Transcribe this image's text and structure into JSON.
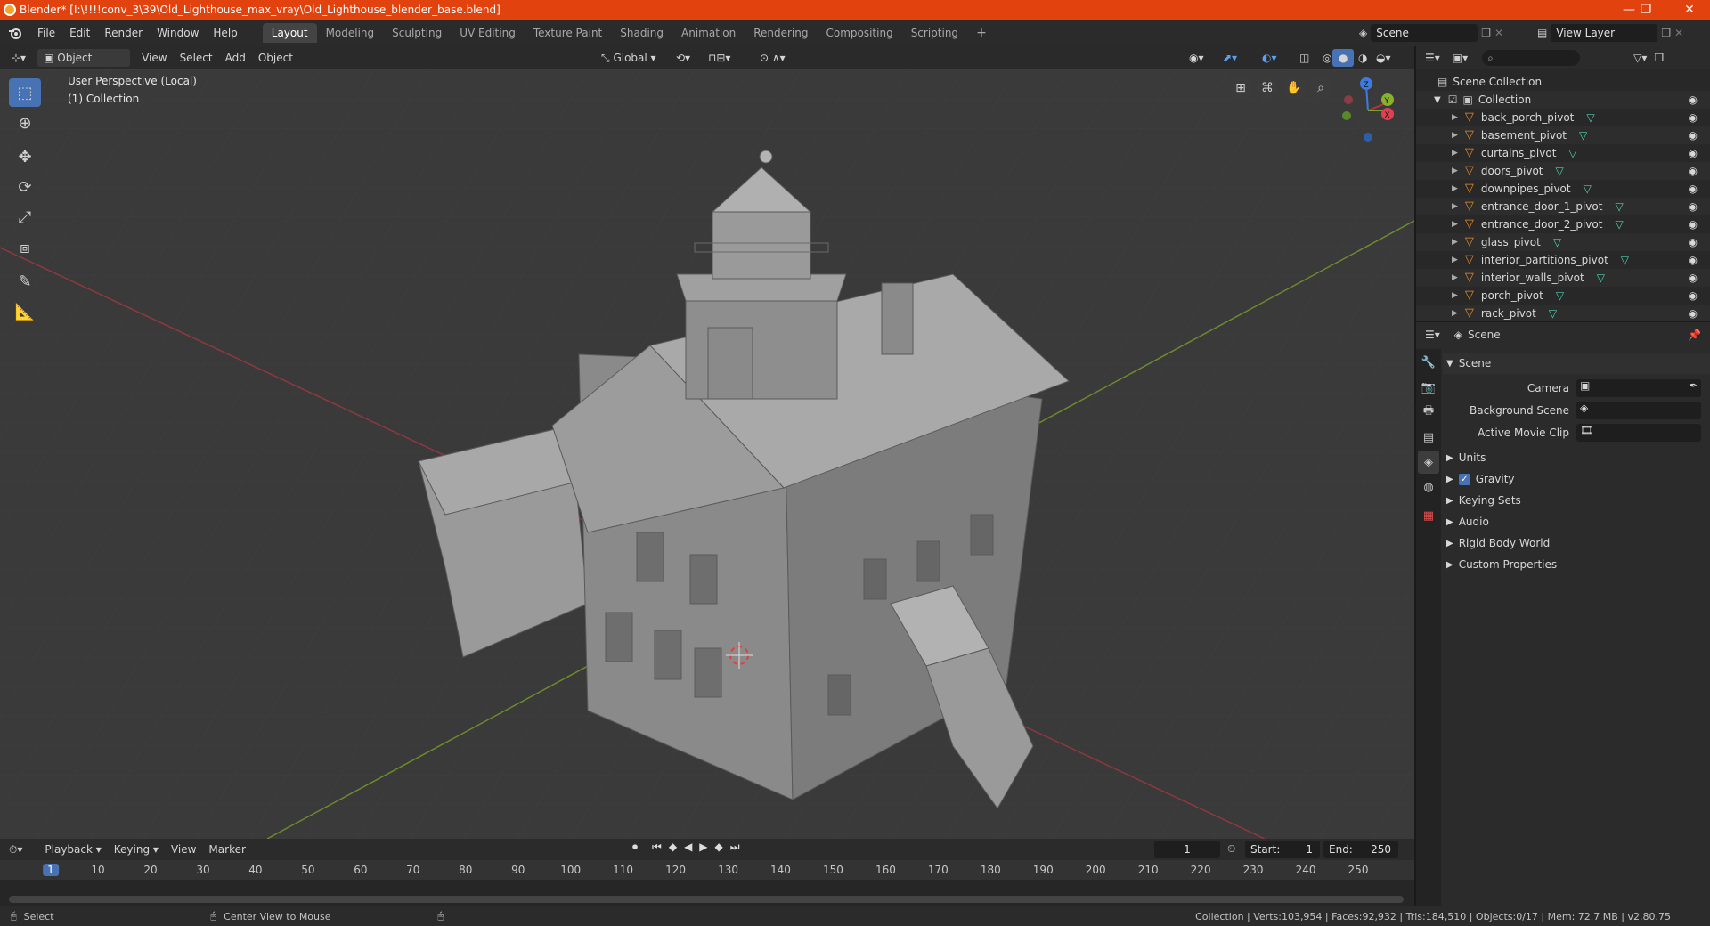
{
  "window": {
    "title": "Blender* [I:\\!!!!conv_3\\39\\Old_Lighthouse_max_vray\\Old_Lighthouse_blender_base.blend]",
    "minimize": "—",
    "maximize": "❐",
    "close": "✕"
  },
  "menu": [
    "File",
    "Edit",
    "Render",
    "Window",
    "Help"
  ],
  "workspaces": [
    "Layout",
    "Modeling",
    "Sculpting",
    "UV Editing",
    "Texture Paint",
    "Shading",
    "Animation",
    "Rendering",
    "Compositing",
    "Scripting"
  ],
  "add_workspace": "+",
  "scene_field": "Scene",
  "view_layer_field": "View Layer",
  "viewport_header": {
    "mode": "Object Mode",
    "menus": [
      "View",
      "Select",
      "Add",
      "Object"
    ],
    "transform_orientation": "Global"
  },
  "viewport": {
    "perspective_label": "User Perspective (Local)",
    "collection_label": "(1) Collection",
    "gizmo_axes": {
      "x": "X",
      "y": "Y",
      "z": "Z"
    }
  },
  "outliner": {
    "root": "Scene Collection",
    "collection": "Collection",
    "items": [
      "back_porch_pivot",
      "basement_pivot",
      "curtains_pivot",
      "doors_pivot",
      "downpipes_pivot",
      "entrance_door_1_pivot",
      "entrance_door_2_pivot",
      "glass_pivot",
      "interior_partitions_pivot",
      "interior_walls_pivot",
      "porch_pivot",
      "rack_pivot"
    ]
  },
  "properties": {
    "header": "Scene",
    "panel_title": "Scene",
    "fields": [
      {
        "label": "Camera",
        "value": ""
      },
      {
        "label": "Background Scene",
        "value": ""
      },
      {
        "label": "Active Movie Clip",
        "value": ""
      }
    ],
    "sections": [
      "Units",
      "Gravity",
      "Keying Sets",
      "Audio",
      "Rigid Body World",
      "Custom Properties"
    ],
    "gravity_checked": true
  },
  "timeline": {
    "menus": [
      "Playback",
      "Keying",
      "View",
      "Marker"
    ],
    "current_frame": "1",
    "start_label": "Start:",
    "start": "1",
    "end_label": "End:",
    "end": "250",
    "ticks": [
      "1",
      "10",
      "20",
      "30",
      "40",
      "50",
      "60",
      "70",
      "80",
      "90",
      "100",
      "110",
      "120",
      "130",
      "140",
      "150",
      "160",
      "170",
      "180",
      "190",
      "200",
      "210",
      "220",
      "230",
      "240",
      "250"
    ]
  },
  "status": {
    "select": "Select",
    "center_view": "Center View to Mouse",
    "stats": "Collection | Verts:103,954 | Faces:92,932 | Tris:184,510 | Objects:0/17 | Mem: 72.7 MB | v2.80.75"
  },
  "colors": {
    "accent": "#4772b3",
    "titlebar": "#e2420e",
    "x_axis": "#b5343f",
    "y_axis": "#7ca22e",
    "z_axis": "#3d7be0"
  }
}
